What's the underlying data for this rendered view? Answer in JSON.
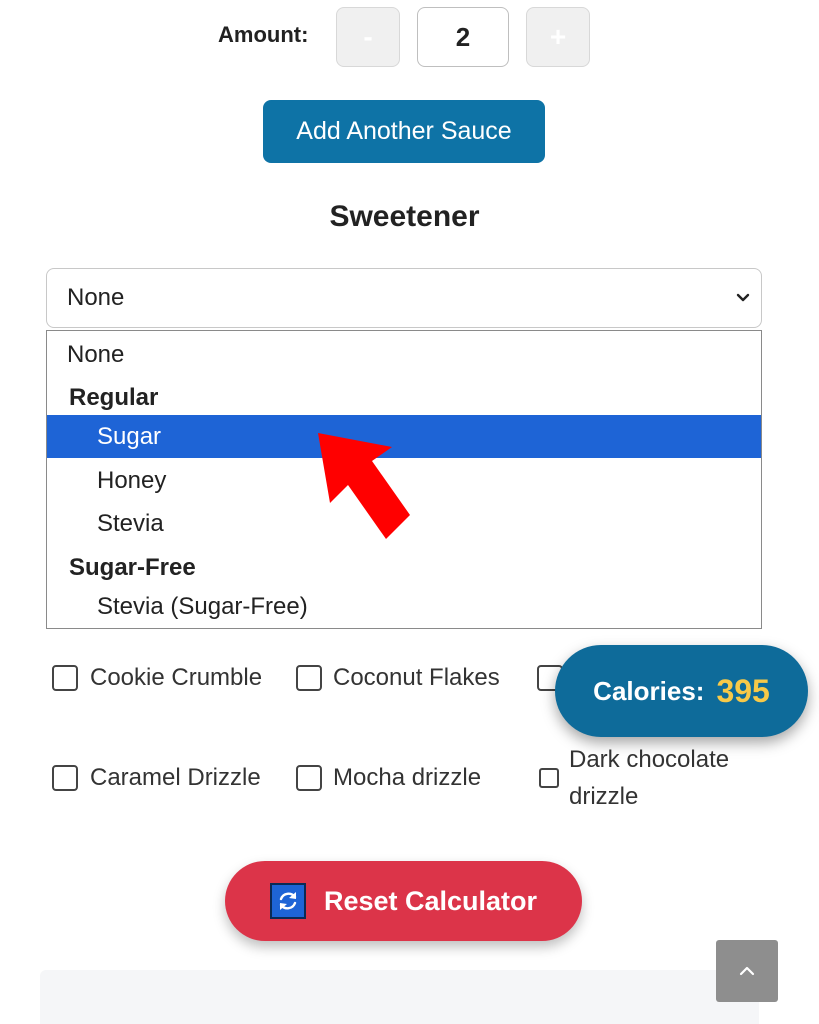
{
  "amount": {
    "label": "Amount:",
    "minus_label": "-",
    "value": "2",
    "plus_label": "+"
  },
  "add_sauce_label": "Add Another Sauce",
  "sweetener": {
    "title": "Sweetener",
    "selected": "None",
    "dropdown": {
      "none": "None",
      "group_regular": "Regular",
      "sugar": "Sugar",
      "honey": "Honey",
      "stevia": "Stevia",
      "group_sugar_free": "Sugar-Free",
      "stevia_sugar_free": "Stevia (Sugar-Free)"
    },
    "highlighted": "Sugar"
  },
  "toppings": {
    "cookie_crumble": "Cookie Crumble",
    "coconut_flakes": "Coconut Flakes",
    "caramel_drizzle": "Caramel Drizzle",
    "mocha_drizzle": "Mocha drizzle",
    "dark_chocolate_drizzle": "Dark chocolate drizzle"
  },
  "calories": {
    "label": "Calories:",
    "value": "395"
  },
  "reset_label": "Reset Calculator",
  "icons": {
    "chevron": "chevron-down-icon",
    "refresh": "refresh-icon",
    "back_to_top": "chevron-up-icon",
    "pointer": "red-arrow-pointer"
  },
  "colors": {
    "primary": "#0e73a6",
    "highlight": "#1e64d6",
    "danger": "#dc3449",
    "calorie_value": "#f7c948"
  }
}
